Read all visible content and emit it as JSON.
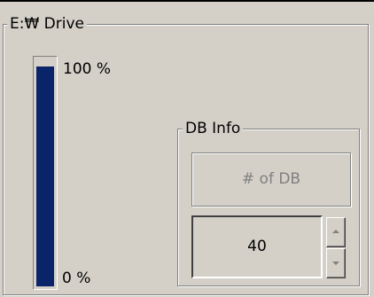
{
  "drive_group": {
    "title": "E:₩ Drive"
  },
  "usage_bar": {
    "label_top": "100 %",
    "label_bottom": "0 %",
    "fill_percent": 97,
    "fill_color": "#0a246a"
  },
  "db_info": {
    "title": "DB Info",
    "count_label": "# of DB",
    "count_value": "40"
  },
  "icons": {
    "spin_up": "up-arrow-icon",
    "spin_down": "down-arrow-icon"
  }
}
